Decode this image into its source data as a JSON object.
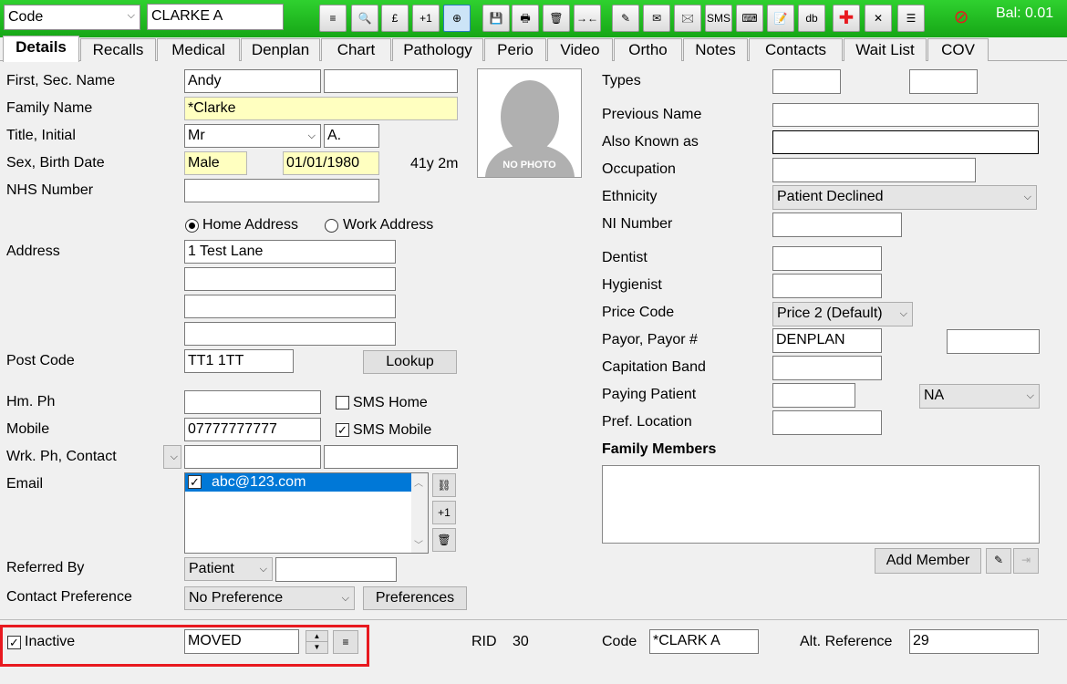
{
  "toolbar": {
    "code_combo": "Code",
    "patient_name": "CLARKE A",
    "buttons": [
      "≡",
      "🔍",
      "£",
      "+1",
      "⊕",
      "💾",
      "🖶",
      "🗑",
      "→←",
      "✎",
      "✉",
      "🖂",
      "SMS",
      "⌨",
      "📝",
      "db",
      "✚",
      "✕",
      "☰",
      "⊘"
    ],
    "balance": "Bal: 0.01"
  },
  "tabs": [
    "Details",
    "Recalls",
    "Medical",
    "Denplan",
    "Chart",
    "Pathology",
    "Perio",
    "Video",
    "Ortho",
    "Notes",
    "Contacts",
    "Wait List",
    "COV"
  ],
  "left": {
    "first_sec_label": "First, Sec. Name",
    "first_name": "Andy",
    "second_name": "",
    "family_label": "Family Name",
    "family_name": "*Clarke",
    "title_label": "Title, Initial",
    "title": "Mr",
    "initial": "A.",
    "sex_label": "Sex, Birth Date",
    "sex": "Male",
    "birth_date": "01/01/1980",
    "age": "41y 2m",
    "nhs_label": "NHS Number",
    "nhs": "",
    "home_address": "Home Address",
    "work_address": "Work Address",
    "address_label": "Address",
    "address": [
      "1 Test Lane",
      "",
      "",
      ""
    ],
    "postcode_label": "Post Code",
    "postcode": "TT1 1TT",
    "lookup": "Lookup",
    "hm_ph_label": "Hm. Ph",
    "hm_ph": "",
    "sms_home": "SMS Home",
    "mobile_label": "Mobile",
    "mobile": "07777777777",
    "sms_mobile": "SMS Mobile",
    "wrk_label": "Wrk. Ph, Contact",
    "wrk_ph": "",
    "contact": "",
    "email_label": "Email",
    "email": "abc@123.com",
    "referred_label": "Referred By",
    "referred_type": "Patient",
    "referred_by": "",
    "contact_pref_label": "Contact Preference",
    "contact_pref": "No Preference",
    "preferences": "Preferences",
    "no_photo": "NO PHOTO"
  },
  "right": {
    "types_label": "Types",
    "prev_name_label": "Previous Name",
    "aka_label": "Also Known as",
    "occupation_label": "Occupation",
    "ethnicity_label": "Ethnicity",
    "ethnicity": "Patient Declined",
    "ni_label": "NI Number",
    "dentist_label": "Dentist",
    "hygienist_label": "Hygienist",
    "price_label": "Price Code",
    "price": "Price 2 (Default)",
    "payor_label": "Payor, Payor #",
    "payor": "DENPLAN",
    "capitation_label": "Capitation Band",
    "paying_label": "Paying Patient",
    "paying_na": "NA",
    "pref_loc_label": "Pref. Location",
    "family_label": "Family Members",
    "add_member": "Add Member"
  },
  "bottom": {
    "inactive_label": "Inactive",
    "inactive_reason": "MOVED",
    "rid_label": "RID",
    "rid": "30",
    "code_label": "Code",
    "code": "*CLARK A",
    "alt_label": "Alt. Reference",
    "alt": "29"
  },
  "colors": {
    "toolbar_green": "#22c022",
    "highlight": "#e8191f",
    "selection": "#0078d7"
  }
}
